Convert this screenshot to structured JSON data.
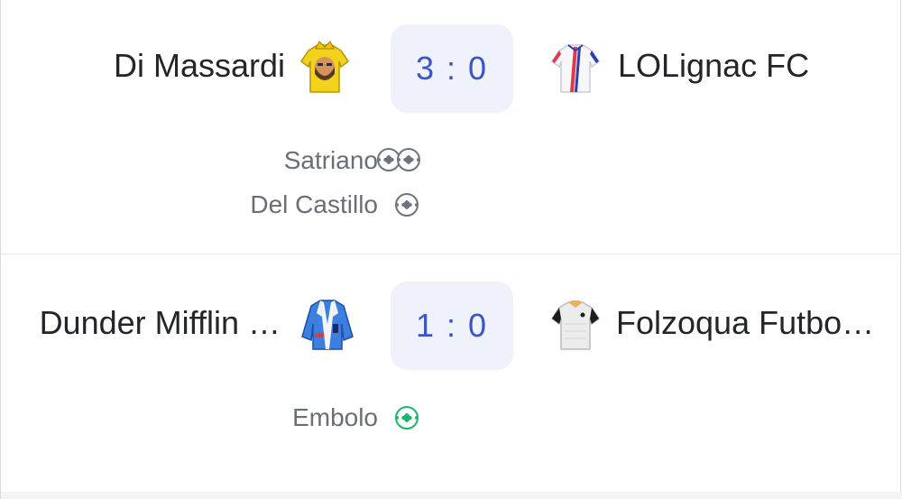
{
  "matches": [
    {
      "home": {
        "name": "Di Massardi",
        "kit_icon": "yellow-king-jersey-icon"
      },
      "score": "3 : 0",
      "away": {
        "name": "LOLignac FC",
        "kit_icon": "white-red-blue-jersey-icon"
      },
      "scorers": [
        {
          "name": "Satriano",
          "goals": 2,
          "ball_color": "#6e7380"
        },
        {
          "name": "Del Castillo",
          "goals": 1,
          "ball_color": "#6e7380"
        }
      ]
    },
    {
      "home": {
        "name": "Dunder Mifflin …",
        "kit_icon": "blue-jacket-jersey-icon"
      },
      "score": "1 : 0",
      "away": {
        "name": "Folzoqua Futbo…",
        "kit_icon": "white-black-sleeve-jersey-icon"
      },
      "scorers": [
        {
          "name": "Embolo",
          "goals": 1,
          "ball_color": "#18b86a"
        }
      ]
    }
  ],
  "colors": {
    "score_text": "#3a55c9",
    "score_bg": "#eff1fb",
    "team_text": "#23252b",
    "scorer_text": "#6a6e78"
  }
}
